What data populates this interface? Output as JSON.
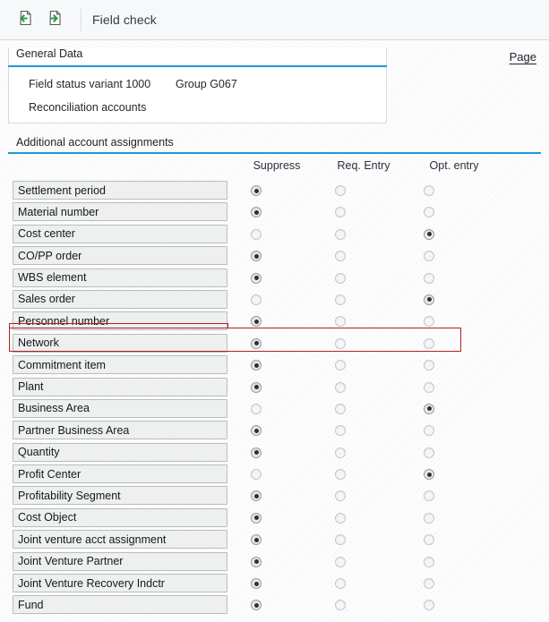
{
  "toolbar": {
    "back_icon": "document-back-arrow-icon",
    "forward_icon": "document-forward-arrow-icon",
    "title": "Field check"
  },
  "page_link": {
    "label": "Page"
  },
  "general_data": {
    "section_title": "General Data",
    "field_status_variant": "Field status variant 1000",
    "group": "Group G067",
    "reconciliation_accounts": "Reconciliation accounts"
  },
  "additional_assignments": {
    "section_title": "Additional account assignments",
    "columns": [
      "Suppress",
      "Req. Entry",
      "Opt. entry"
    ],
    "rows": [
      {
        "label": "Settlement period",
        "selected": 0
      },
      {
        "label": "Material number",
        "selected": 0
      },
      {
        "label": "Cost center",
        "selected": 2
      },
      {
        "label": "CO/PP order",
        "selected": 0
      },
      {
        "label": "WBS element",
        "selected": 0
      },
      {
        "label": "Sales order",
        "selected": 2,
        "highlighted": true
      },
      {
        "label": "Personnel number",
        "selected": 0
      },
      {
        "label": "Network",
        "selected": 0
      },
      {
        "label": "Commitment item",
        "selected": 0
      },
      {
        "label": "Plant",
        "selected": 0
      },
      {
        "label": "Business Area",
        "selected": 2
      },
      {
        "label": "Partner Business Area",
        "selected": 0
      },
      {
        "label": "Quantity",
        "selected": 0
      },
      {
        "label": "Profit Center",
        "selected": 2
      },
      {
        "label": "Profitability Segment",
        "selected": 0
      },
      {
        "label": "Cost Object",
        "selected": 0
      },
      {
        "label": "Joint venture acct assignment",
        "selected": 0
      },
      {
        "label": "Joint Venture Partner",
        "selected": 0
      },
      {
        "label": "Joint Venture Recovery Indctr",
        "selected": 0
      },
      {
        "label": "Fund",
        "selected": 0
      }
    ]
  },
  "colors": {
    "accent": "#1b9ad6",
    "annotation": "#b42020",
    "icon_green": "#2e9b4f",
    "field_bg": "#eeefef"
  }
}
